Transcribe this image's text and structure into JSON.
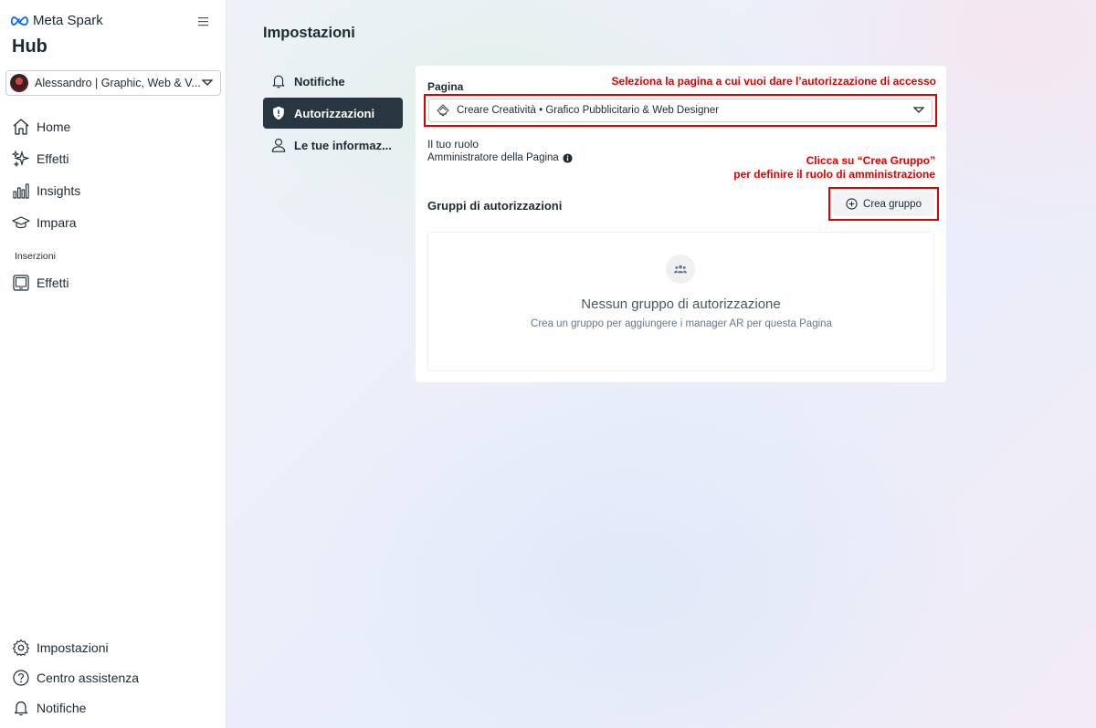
{
  "brand": {
    "logo_text": "Meta Spark",
    "hub": "Hub"
  },
  "account": {
    "name": "Alessandro | Graphic, Web & V..."
  },
  "sidebar": {
    "items": [
      {
        "label": "Home"
      },
      {
        "label": "Effetti"
      },
      {
        "label": "Insights"
      },
      {
        "label": "Impara"
      }
    ],
    "section_label": "Inserzioni",
    "section_items": [
      {
        "label": "Effetti"
      }
    ],
    "bottom_items": [
      {
        "label": "Impostazioni"
      },
      {
        "label": "Centro assistenza"
      },
      {
        "label": "Notifiche"
      }
    ]
  },
  "main": {
    "title": "Impostazioni",
    "tabs": [
      {
        "label": "Notifiche"
      },
      {
        "label": "Autorizzazioni"
      },
      {
        "label": "Le tue informaz..."
      }
    ],
    "active_tab": "Autorizzazioni",
    "card": {
      "annotation_page": "Seleziona la pagina a cui vuoi dare l’autorizzazione di accesso",
      "page_label": "Pagina",
      "page_value": "Creare Creatività • Grafico Pubblicitario & Web Designer",
      "role_label": "Il tuo ruolo",
      "role_value": "Amministratore della Pagina",
      "annotation_create_line1": "Clicca su “Crea Gruppo”",
      "annotation_create_line2": "per definire il ruolo di amministrazione",
      "groups_label": "Gruppi di autorizzazioni",
      "create_button": "Crea gruppo",
      "empty_title": "Nessun gruppo di autorizzazione",
      "empty_subtitle": "Crea un gruppo per aggiungere i manager AR per questa Pagina"
    }
  },
  "colors": {
    "accent_dark": "#283642",
    "annotation_red": "#e00000",
    "meta_blue": "#0866ff"
  }
}
